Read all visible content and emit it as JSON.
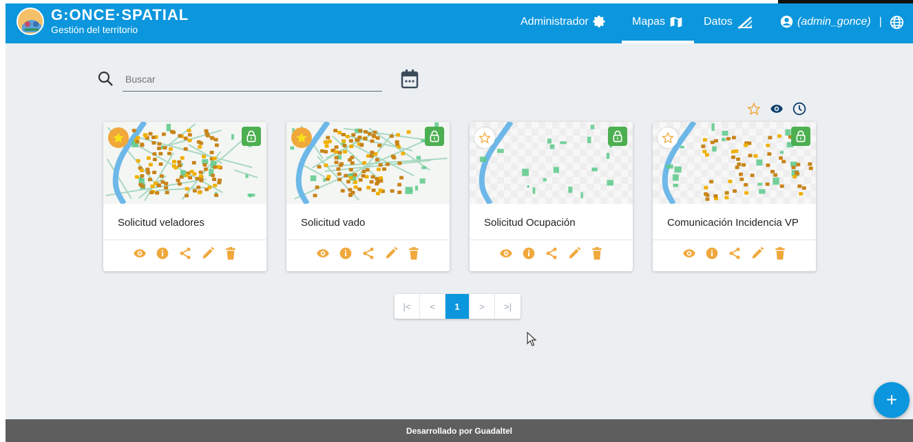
{
  "header": {
    "brand_name": "G:ONCE·SPATIAL",
    "brand_subtitle": "Gestión del territorio",
    "nav": {
      "admin": "Administrador",
      "maps": "Mapas",
      "data": "Datos",
      "user": "(admin_gonce)",
      "separator": "|"
    },
    "active_nav": "Mapas"
  },
  "search": {
    "placeholder": "Buscar",
    "value": ""
  },
  "sort_icons": [
    "star-outline-icon",
    "eye-icon",
    "clock-icon"
  ],
  "cards": [
    {
      "title": "Solicitud veladores",
      "favorite": true,
      "locked": true
    },
    {
      "title": "Solicitud vado",
      "favorite": true,
      "locked": true
    },
    {
      "title": "Solicitud Ocupación",
      "favorite": false,
      "locked": true
    },
    {
      "title": "Comunicación Incidencia VP",
      "favorite": false,
      "locked": true
    }
  ],
  "card_actions": [
    "eye-icon",
    "info-icon",
    "share-icon",
    "pencil-icon",
    "trash-icon"
  ],
  "pagination": {
    "first": "|<",
    "prev": "<",
    "current": "1",
    "next": ">",
    "last": ">|"
  },
  "fab_label": "+",
  "footer": {
    "text": "Desarrollado por Guadaltel"
  },
  "colors": {
    "primary": "#0b96dd",
    "accent_orange": "#f0a83c",
    "lock_green": "#4caf50",
    "background": "#eceff2",
    "footer": "#5e5e5e"
  }
}
